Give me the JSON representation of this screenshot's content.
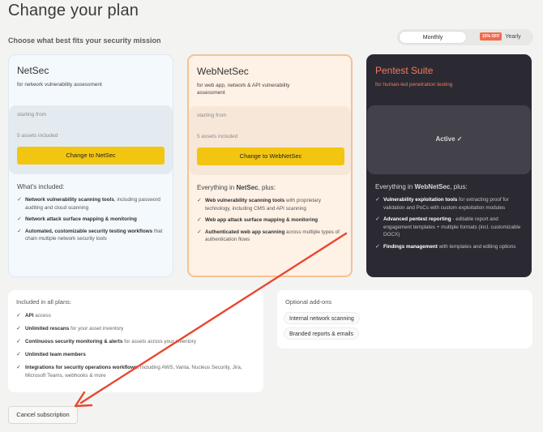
{
  "page": {
    "title": "Change your plan",
    "subtitle": "Choose what best fits your security mission"
  },
  "billing": {
    "monthly_label": "Monthly",
    "yearly_label": "Yearly",
    "discount_badge": "15% OFF",
    "selected": "Monthly"
  },
  "plans": [
    {
      "name": "NetSec",
      "description": "for network vulnerability assessment",
      "starting_from": "starting from",
      "assets": "5 assets included",
      "button_label": "Change to NetSec",
      "included_heading": "What's included:",
      "features": [
        {
          "bold": "Network vulnerability scanning tools",
          "rest": ", including password auditing and cloud scanning"
        },
        {
          "bold": "Network attack surface mapping & monitoring",
          "rest": ""
        },
        {
          "bold": "Automated, customizable security testing workflows",
          "rest": " that chain multiple network security tools"
        }
      ]
    },
    {
      "name": "WebNetSec",
      "description": "for web app, network & API vulnerability assessment",
      "starting_from": "starting from",
      "assets": "5 assets included",
      "button_label": "Change to WebNetSec",
      "included_heading_prefix": "Everything in ",
      "included_heading_bold": "NetSec",
      "included_heading_suffix": ", plus:",
      "features": [
        {
          "bold": "Web vulnerability scanning tools",
          "rest": " with proprietary technology, including CMS and API scanning"
        },
        {
          "bold": "Web app attack surface mapping & monitoring",
          "rest": ""
        },
        {
          "bold": "Authenticated web app scanning",
          "rest": " across multiple types of authentication flows"
        }
      ]
    },
    {
      "name": "Pentest Suite",
      "description": "for human-led penetration testing",
      "status_label": "Active ✓",
      "included_heading_prefix": "Everything in ",
      "included_heading_bold": "WebNetSec",
      "included_heading_suffix": ", plus:",
      "features": [
        {
          "bold": "Vulnerability exploitation tools",
          "rest": " for extracting proof for validation and PoCs with custom exploitation modules"
        },
        {
          "bold": "Advanced pentest reporting",
          "rest": " - editable report and engagement templates + multiple formats (incl. customizable DOCX)"
        },
        {
          "bold": "Findings management",
          "rest": " with templates and editing options"
        }
      ]
    }
  ],
  "included_all": {
    "heading": "Included in all plans:",
    "items": [
      {
        "bold": "API",
        "rest": " access"
      },
      {
        "bold": "Unlimited rescans",
        "rest": " for your asset inventory"
      },
      {
        "bold": "Continuous security monitoring & alerts",
        "rest": " for assets across your inventory"
      },
      {
        "bold": "Unlimited team members",
        "rest": ""
      },
      {
        "bold": "Integrations for security operations workflows",
        "rest": ", including AWS, Vanta, Nucleus Security, Jira, Microsoft Teams, webhooks & more"
      }
    ]
  },
  "addons": {
    "heading": "Optional add-ons",
    "items": [
      "Internal network scanning",
      "Branded reports & emails"
    ]
  },
  "cancel": {
    "label": "Cancel subscription"
  },
  "colors": {
    "accent_yellow": "#f2c511",
    "pentest_dark": "#2b2a33",
    "annotation_red": "#e8472e",
    "discount_orange": "#f06b4f"
  }
}
